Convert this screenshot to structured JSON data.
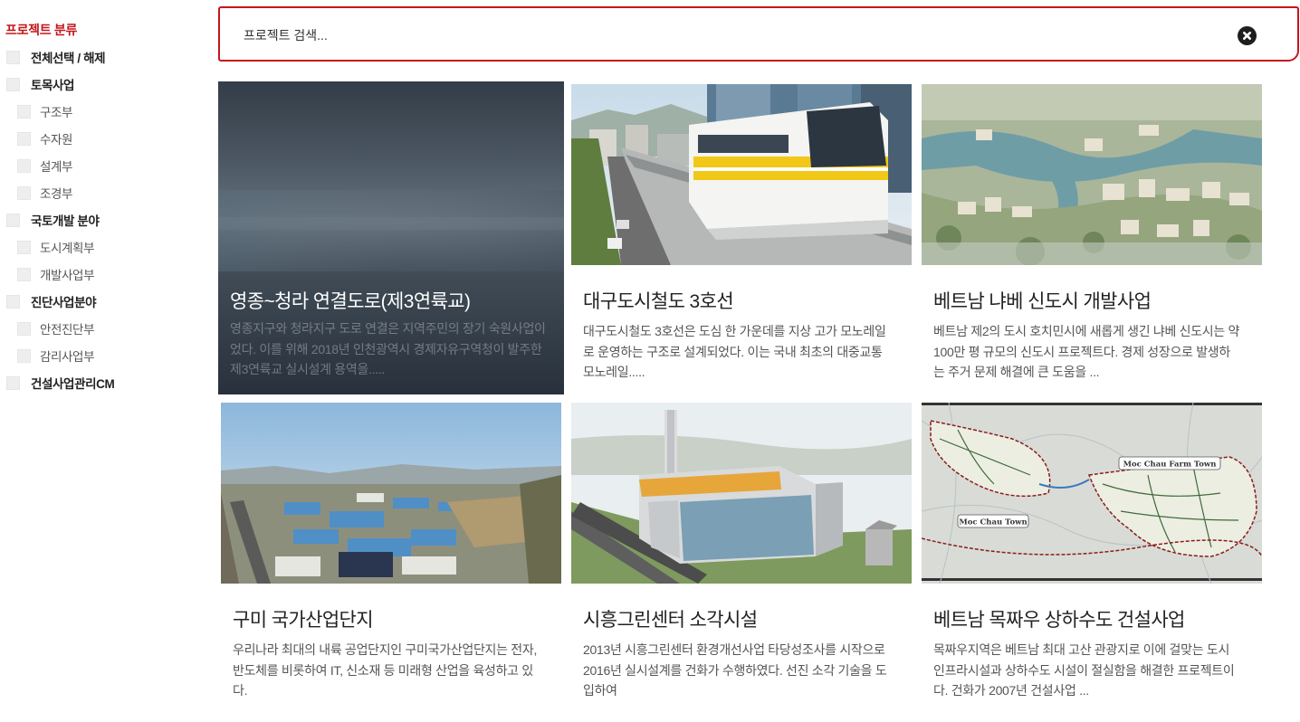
{
  "sidebar": {
    "title": "프로젝트 분류",
    "items": [
      {
        "label": "전체선택 / 해제",
        "level": 0
      },
      {
        "label": "토목사업",
        "level": 0
      },
      {
        "label": "구조부",
        "level": 1
      },
      {
        "label": "수자원",
        "level": 1
      },
      {
        "label": "설계부",
        "level": 1
      },
      {
        "label": "조경부",
        "level": 1
      },
      {
        "label": "국토개발 분야",
        "level": 0
      },
      {
        "label": "도시계획부",
        "level": 1
      },
      {
        "label": "개발사업부",
        "level": 1
      },
      {
        "label": "진단사업분야",
        "level": 0
      },
      {
        "label": "안전진단부",
        "level": 1
      },
      {
        "label": "감리사업부",
        "level": 1
      },
      {
        "label": "건설사업관리CM",
        "level": 0
      }
    ]
  },
  "search": {
    "placeholder": "프로젝트 검색...",
    "value": "",
    "clear_icon": "close-circle-icon"
  },
  "colors": {
    "accent": "#c4161c",
    "overlay": "#2b3440"
  },
  "projects": [
    {
      "title": "영종~청라 연결도로(제3연륙교)",
      "description": "영종지구와 청라지구 도로 연결은 지역주민의 장기 숙원사업이었다. 이를 위해 2018년 인천광역시 경제자유구역청이 발주한 제3연륙교 실시설계 용역을.....",
      "image": "sea-bridge-photo",
      "state": "hover"
    },
    {
      "title": "대구도시철도 3호선",
      "description": "대구도시철도 3호선은 도심 한 가운데를 지상 고가 모노레일로 운영하는 구조로 설계되었다. 이는 국내 최초의 대중교통 모노레일.....",
      "image": "monorail-photo",
      "state": "normal"
    },
    {
      "title": "베트남 냐베 신도시 개발사업",
      "description": "베트남 제2의 도시 호치민시에 새롭게 생긴 냐베 신도시는 약 100만 평 규모의 신도시 프로젝트다. 경제 성장으로 발생하는 주거 문제 해결에 큰 도움을 ...",
      "image": "new-city-aerial-rendering",
      "state": "normal"
    },
    {
      "title": "구미 국가산업단지",
      "description": "우리나라 최대의 내륙 공업단지인 구미국가산업단지는 전자, 반도체를 비롯하여 IT, 신소재 등 미래형 산업을 육성하고 있다.",
      "image": "industrial-complex-aerial",
      "state": "normal"
    },
    {
      "title": "시흥그린센터 소각시설",
      "description": "2013년 시흥그린센터 환경개선사업 타당성조사를 시작으로 2016년 실시설계를 건화가 수행하였다. 선진 소각 기술을 도입하여",
      "image": "incinerator-facility-rendering",
      "state": "normal"
    },
    {
      "title": "베트남 목짜우 상하수도 건설사업",
      "description": "목짜우지역은 베트남 최대 고산 관광지로 이에 걸맞는 도시 인프라시설과  상하수도 시설이 절실함을 해결한 프로젝트이다. 건화가 2007년 건설사업 ...",
      "image": "water-network-map",
      "state": "normal",
      "map_labels": [
        "Moc Chau Farm Town",
        "Moc Chau Town"
      ]
    }
  ]
}
